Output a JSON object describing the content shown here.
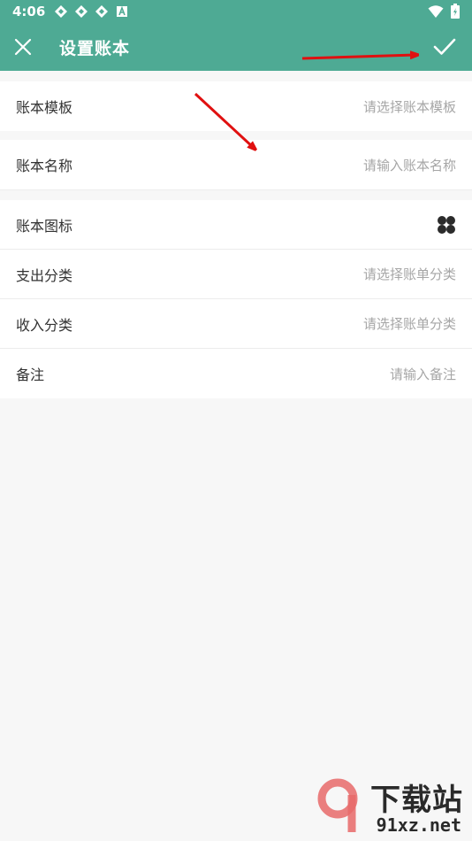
{
  "status_bar": {
    "time": "4:06",
    "icons": [
      "app-notify-icon",
      "app-notify-icon",
      "app-notify-icon",
      "a-badge-icon"
    ],
    "right_icons": [
      "wifi-icon",
      "battery-icon"
    ]
  },
  "app_bar": {
    "title": "设置账本",
    "close_icon": "close-icon",
    "confirm_icon": "check-icon",
    "background": "#4eaa94"
  },
  "form": {
    "template": {
      "label": "账本模板",
      "placeholder": "请选择账本模板"
    },
    "name": {
      "label": "账本名称",
      "placeholder": "请输入账本名称"
    },
    "icon": {
      "label": "账本图标",
      "icon": "clover-grid-icon"
    },
    "expense_category": {
      "label": "支出分类",
      "placeholder": "请选择账单分类"
    },
    "income_category": {
      "label": "收入分类",
      "placeholder": "请选择账单分类"
    },
    "note": {
      "label": "备注",
      "placeholder": "请输入备注"
    }
  },
  "watermark": {
    "brand_text": "下载站",
    "url_text": "91xz.net"
  }
}
